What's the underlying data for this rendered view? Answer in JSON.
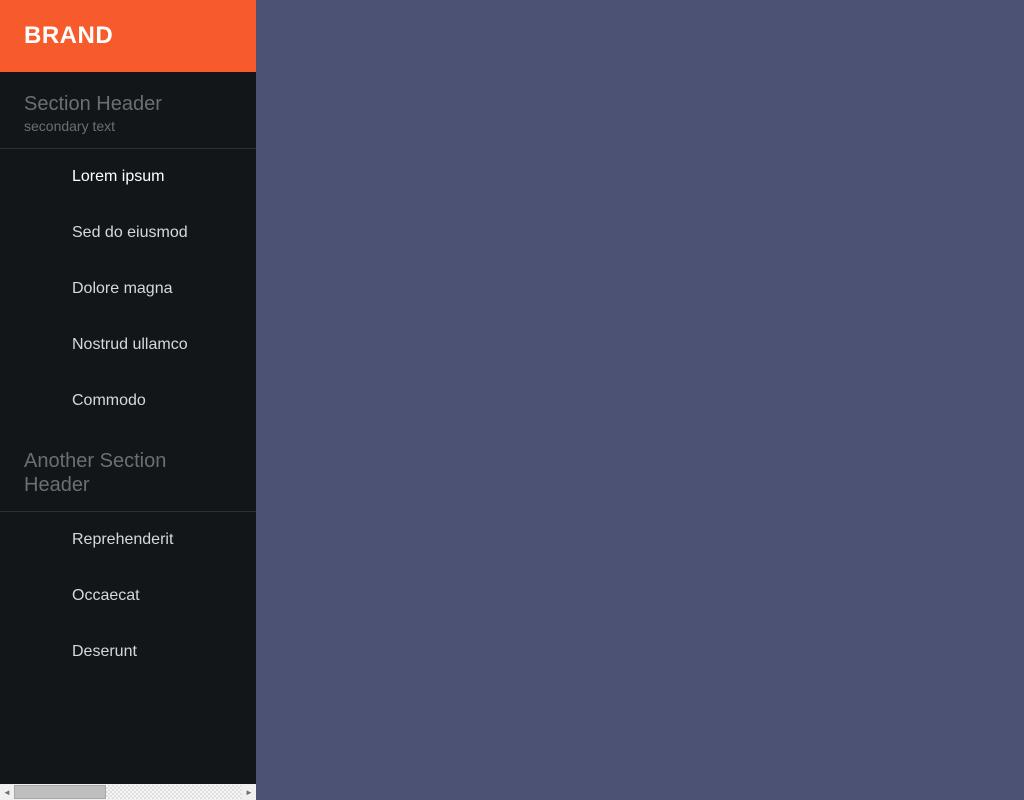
{
  "brand": "BRAND",
  "sections": [
    {
      "title": "Section Header",
      "secondary": "secondary text",
      "items": [
        {
          "label": "Lorem ipsum",
          "active": true
        },
        {
          "label": "Sed do eiusmod",
          "active": false
        },
        {
          "label": "Dolore magna",
          "active": false
        },
        {
          "label": "Nostrud ullamco",
          "active": false
        },
        {
          "label": "Commodo",
          "active": false
        }
      ]
    },
    {
      "title": "Another Section Header",
      "secondary": null,
      "items": [
        {
          "label": "Reprehenderit",
          "active": false
        },
        {
          "label": "Occaecat",
          "active": false
        },
        {
          "label": "Deserunt",
          "active": false
        }
      ]
    }
  ]
}
